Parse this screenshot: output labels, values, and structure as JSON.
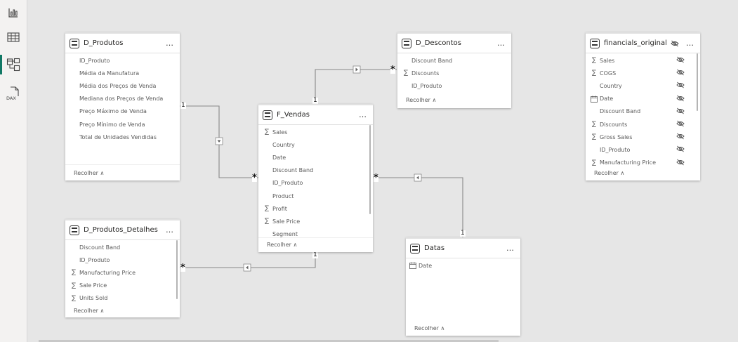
{
  "rail": {
    "items": [
      {
        "name": "report-view-icon"
      },
      {
        "name": "table-view-icon"
      },
      {
        "name": "model-view-icon"
      },
      {
        "name": "dax-query-view-icon",
        "label": "DAX"
      }
    ]
  },
  "tables": {
    "d_produtos": {
      "title": "D_Produtos",
      "more": "…",
      "fields": [
        "ID_Produto",
        "Média da Manufatura",
        "Média dos Preços de Venda",
        "Mediana dos Preços de Venda",
        "Preço Máximo de Venda",
        "Preço Mínimo de Venda",
        "Total de Unidades Vendidas"
      ],
      "footer": "Recolher ∧"
    },
    "d_descontos": {
      "title": "D_Descontos",
      "more": "…",
      "fields": [
        {
          "label": "Discount Band",
          "sigma": ""
        },
        {
          "label": "Discounts",
          "sigma": "∑"
        },
        {
          "label": "ID_Produto",
          "sigma": ""
        }
      ],
      "footer": "Recolher ∧"
    },
    "financials": {
      "title": "financials_original",
      "more": "…",
      "fields": [
        {
          "label": "Sales",
          "icon": "∑"
        },
        {
          "label": "COGS",
          "icon": "∑"
        },
        {
          "label": "Country",
          "icon": ""
        },
        {
          "label": "Date",
          "icon": "cal"
        },
        {
          "label": "Discount Band",
          "icon": ""
        },
        {
          "label": "Discounts",
          "icon": "∑"
        },
        {
          "label": "Gross Sales",
          "icon": "∑"
        },
        {
          "label": "ID_Produto",
          "icon": ""
        },
        {
          "label": "Manufacturing Price",
          "icon": "∑"
        }
      ],
      "footer": "Recolher ∧"
    },
    "f_vendas": {
      "title": "F_Vendas",
      "more": "…",
      "fields": [
        {
          "label": "Sales",
          "sigma": "∑"
        },
        {
          "label": "Country",
          "sigma": ""
        },
        {
          "label": "Date",
          "sigma": ""
        },
        {
          "label": "Discount Band",
          "sigma": ""
        },
        {
          "label": "ID_Produto",
          "sigma": ""
        },
        {
          "label": "Product",
          "sigma": ""
        },
        {
          "label": "Profit",
          "sigma": "∑"
        },
        {
          "label": "Sale Price",
          "sigma": "∑"
        },
        {
          "label": "Segment",
          "sigma": ""
        }
      ],
      "footer": "Recolher ∧"
    },
    "d_produtos_detalhes": {
      "title": "D_Produtos_Detalhes",
      "more": "…",
      "fields": [
        {
          "label": "Discount Band",
          "sigma": ""
        },
        {
          "label": "ID_Produto",
          "sigma": ""
        },
        {
          "label": "Manufacturing Price",
          "sigma": "∑"
        },
        {
          "label": "Sale Price",
          "sigma": "∑"
        },
        {
          "label": "Units Sold",
          "sigma": "∑"
        }
      ],
      "footer": "Recolher ∧"
    },
    "datas": {
      "title": "Datas",
      "more": "…",
      "fields": [
        {
          "label": "Date",
          "icon": "cal"
        }
      ],
      "footer": "Recolher ∧"
    }
  },
  "relationships": {
    "one": "1",
    "many": "*"
  }
}
